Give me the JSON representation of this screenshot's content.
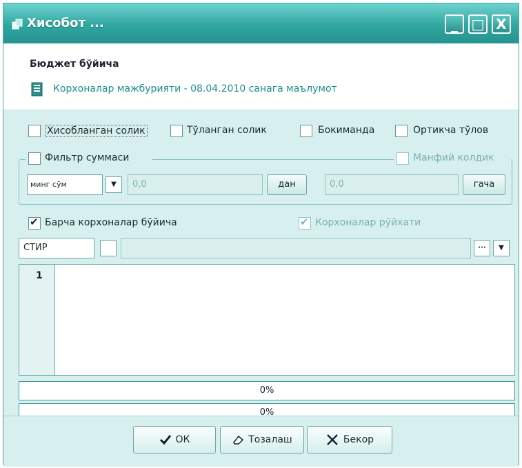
{
  "window": {
    "title": "Хисобот ...",
    "controls": {
      "minimize": "_",
      "maximize": "□",
      "close": "X"
    }
  },
  "header": {
    "title": "Бюджет бўйича",
    "subtitle": "Корхоналар мажбурияти - 08.04.2010 санага маълумот"
  },
  "filters": {
    "options": [
      {
        "label": "Хисобланган солик",
        "checked": false
      },
      {
        "label": "Тўланган солик",
        "checked": false
      },
      {
        "label": "Бокиманда",
        "checked": false
      },
      {
        "label": "Ортикча тўлов",
        "checked": false
      }
    ],
    "sum_filter": {
      "label": "Фильтр суммаси",
      "checked": false,
      "negative_label": "Манфий колдик",
      "unit": "минг сўм",
      "from_value": "0,0",
      "from_button": "дан",
      "to_value": "0,0",
      "to_button": "гача"
    }
  },
  "scope": {
    "all_label": "Барча корхоналар бўйича",
    "all_checked": true,
    "list_label": "Корхоналар рўйхати",
    "list_checked": true,
    "key_field": "СТИР"
  },
  "editor": {
    "line_numbers": [
      "1"
    ]
  },
  "progress": [
    {
      "label": "0%",
      "value": 0
    },
    {
      "label": "0%",
      "value": 0
    }
  ],
  "footer": {
    "ok": "ОК",
    "clear": "Тозалаш",
    "cancel": "Бекор"
  },
  "colors": {
    "accent": "#2fa6a1",
    "background": "#d7f0ef",
    "border": "#6aa7a4"
  }
}
